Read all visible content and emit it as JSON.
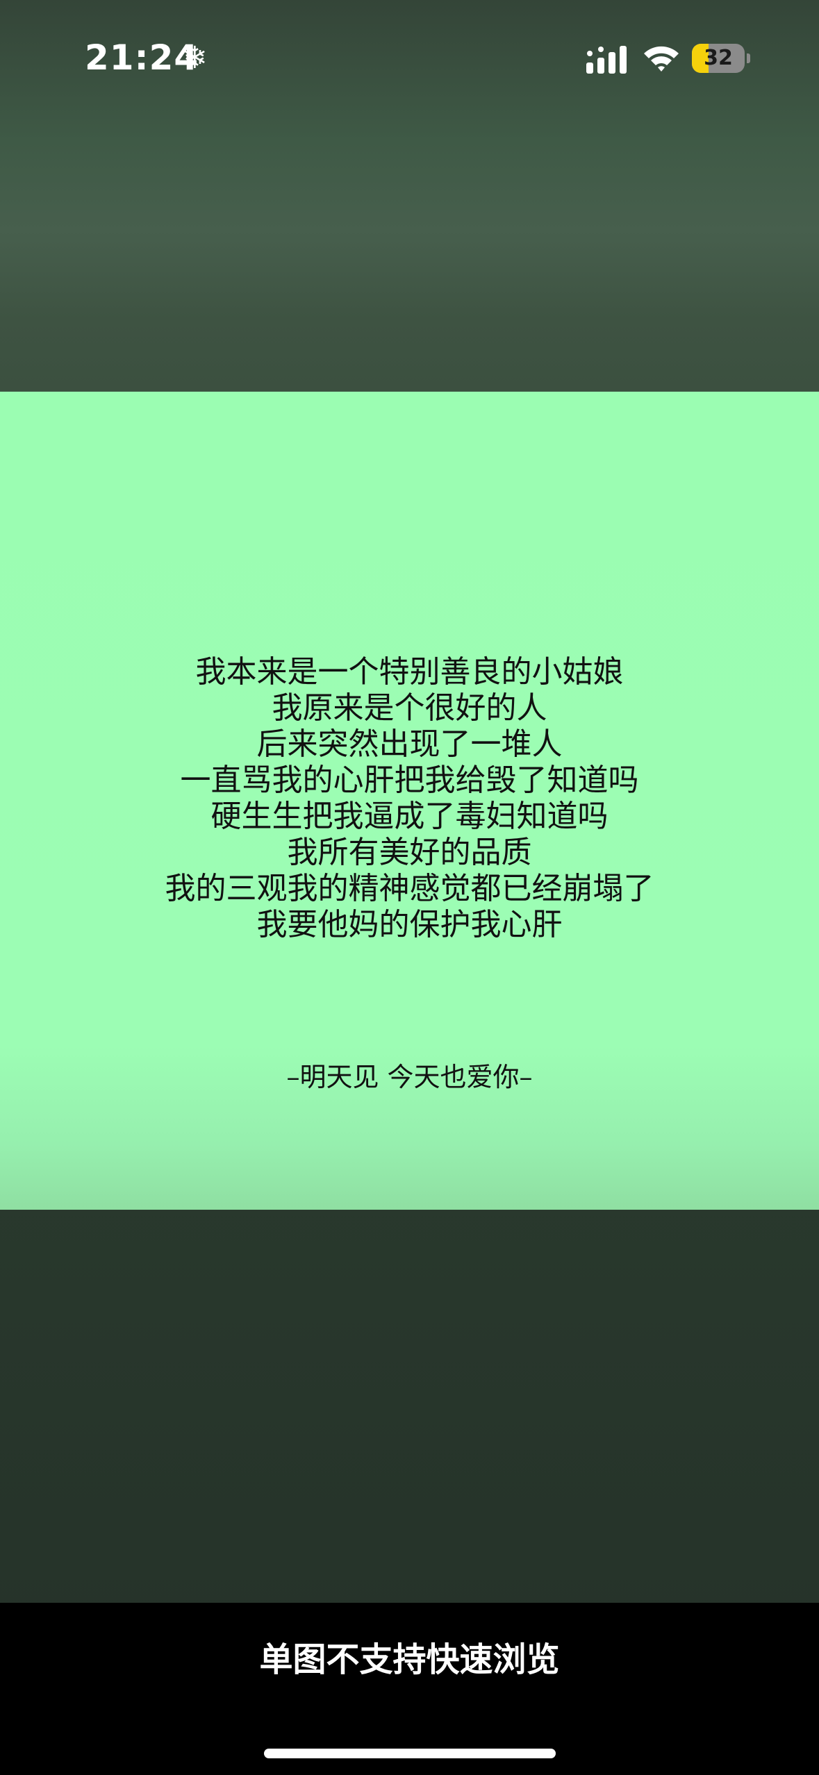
{
  "status_bar": {
    "time": "21:24",
    "snow_glyph": "❄",
    "battery_level": "32",
    "battery_fraction": 0.32,
    "icons": [
      "snowflake-icon",
      "signal-icon",
      "wifi-icon",
      "battery-icon"
    ]
  },
  "image": {
    "poem_lines": [
      "我本来是一个特别善良的小姑娘",
      "我原来是个很好的人",
      "后来突然出现了一堆人",
      "一直骂我的心肝把我给毁了知道吗",
      "硬生生把我逼成了毒妇知道吗",
      "我所有美好的品质",
      "我的三观我的精神感觉都已经崩塌了",
      "我要他妈的保护我心肝"
    ],
    "signature": "–明天见 今天也爱你–",
    "background_color": "#9cfdb4"
  },
  "bottom_bar": {
    "notice": "单图不支持快速浏览"
  },
  "colors": {
    "backdrop": "#3e5342",
    "text": "#111111",
    "battery_fill": "#f5d10c"
  }
}
